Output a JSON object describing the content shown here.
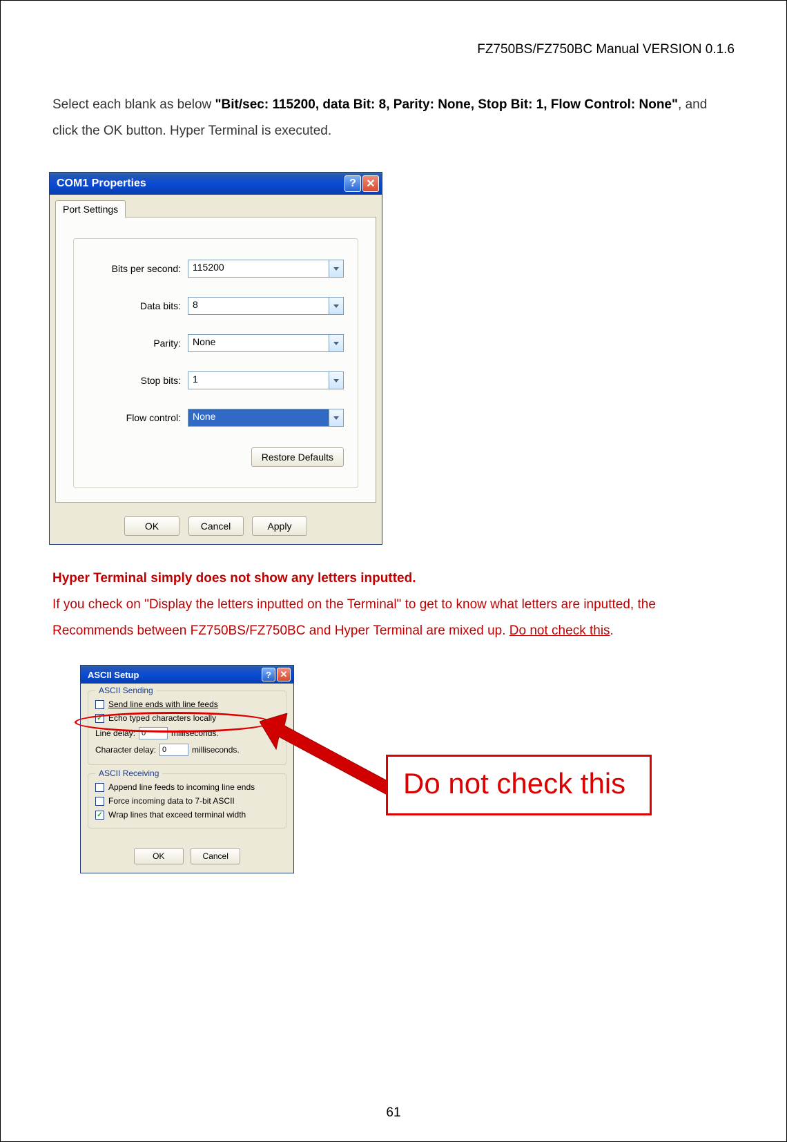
{
  "header": "FZ750BS/FZ750BC Manual VERSION 0.1.6",
  "para1": {
    "p1": "Select each blank as below ",
    "bold": "\"Bit/sec: 115200, data Bit: 8, Parity: None, Stop Bit: 1, Flow Control: None\"",
    "p2": ", and click the OK button. Hyper Terminal is executed."
  },
  "dialog1": {
    "title": "COM1 Properties",
    "tab": "Port Settings",
    "fields": {
      "bits_per_second": {
        "label": "Bits per second:",
        "value": "115200"
      },
      "data_bits": {
        "label": "Data bits:",
        "value": "8"
      },
      "parity": {
        "label": "Parity:",
        "value": "None"
      },
      "stop_bits": {
        "label": "Stop bits:",
        "value": "1"
      },
      "flow_control": {
        "label": "Flow control:",
        "value": "None"
      }
    },
    "restore": "Restore Defaults",
    "ok": "OK",
    "cancel": "Cancel",
    "apply": "Apply"
  },
  "red_para": {
    "bold_line": "Hyper Terminal simply does not show any letters inputted.",
    "line2a": "If you check on \"Display the letters inputted on the Terminal\" to get to know what letters are inputted, the Recommends between FZ750BS/FZ750BC and Hyper Terminal are mixed up. ",
    "underline": "Do not check this",
    "period": "."
  },
  "dialog2": {
    "title": "ASCII Setup",
    "sending_title": "ASCII Sending",
    "send_line_ends": "Send line ends with line feeds",
    "echo": "Echo typed characters locally",
    "line_delay_label": "Line delay:",
    "line_delay_val": "0",
    "char_delay_label": "Character delay:",
    "char_delay_val": "0",
    "ms": "milliseconds.",
    "receiving_title": "ASCII Receiving",
    "append": "Append line feeds to incoming line ends",
    "force7": "Force incoming data to 7-bit ASCII",
    "wrap": "Wrap lines that exceed terminal width",
    "ok": "OK",
    "cancel": "Cancel"
  },
  "callout": "Do not check this",
  "page_num": "61"
}
